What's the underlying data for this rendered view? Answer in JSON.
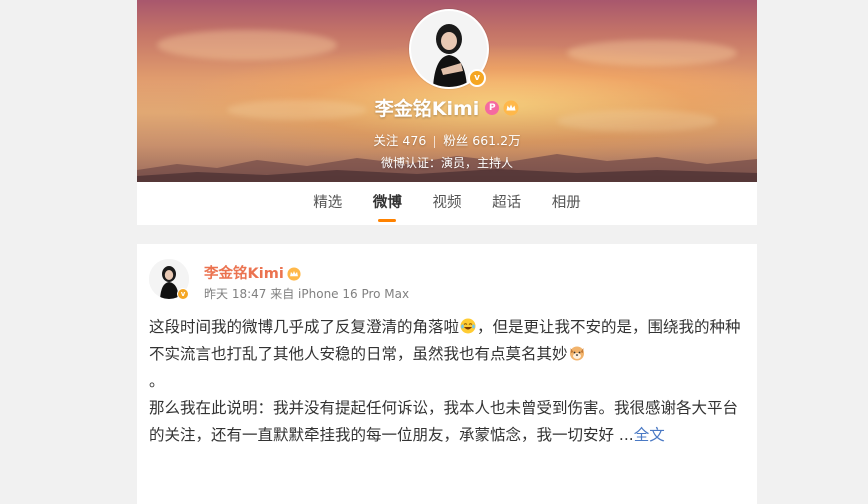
{
  "profile": {
    "name": "李金铭Kimi",
    "vip_icon": "vip-badge-icon",
    "crown_icon": "crown-icon",
    "verified_icon": "verified-v-icon",
    "following_label": "关注",
    "following_count": "476",
    "followers_label": "粉丝",
    "followers_count": "661.2万",
    "verification": "微博认证：演员，主持人"
  },
  "tabs": [
    {
      "label": "精选",
      "active": false
    },
    {
      "label": "微博",
      "active": true
    },
    {
      "label": "视频",
      "active": false
    },
    {
      "label": "超话",
      "active": false
    },
    {
      "label": "相册",
      "active": false
    }
  ],
  "post": {
    "author": "李金铭Kimi",
    "time": "昨天 18:47",
    "source": "来自 iPhone 16 Pro Max",
    "text_part1": "这段时间我的微博几乎成了反复澄清的角落啦",
    "emoji1": "laugh-cry-emoji",
    "text_part2": "，但是更让我不安的是，围绕我的种种不实流言也打乱了其他人安稳的日常，虽然我也有点莫名其妙",
    "emoji2": "dog-face-emoji",
    "text_part3": "。",
    "text_part4": "那么我在此说明：我并没有提起任何诉讼，我本人也未曾受到伤害。我很感谢各大平台的关注，还有一直默默牵挂我的每一位朋友，承蒙惦念，我一切安好 ...",
    "expand_label": "全文"
  },
  "colors": {
    "accent": "#ff8200",
    "author_name": "#eb7350",
    "link": "#4a79c4",
    "page_bg": "#f1f1f1"
  }
}
